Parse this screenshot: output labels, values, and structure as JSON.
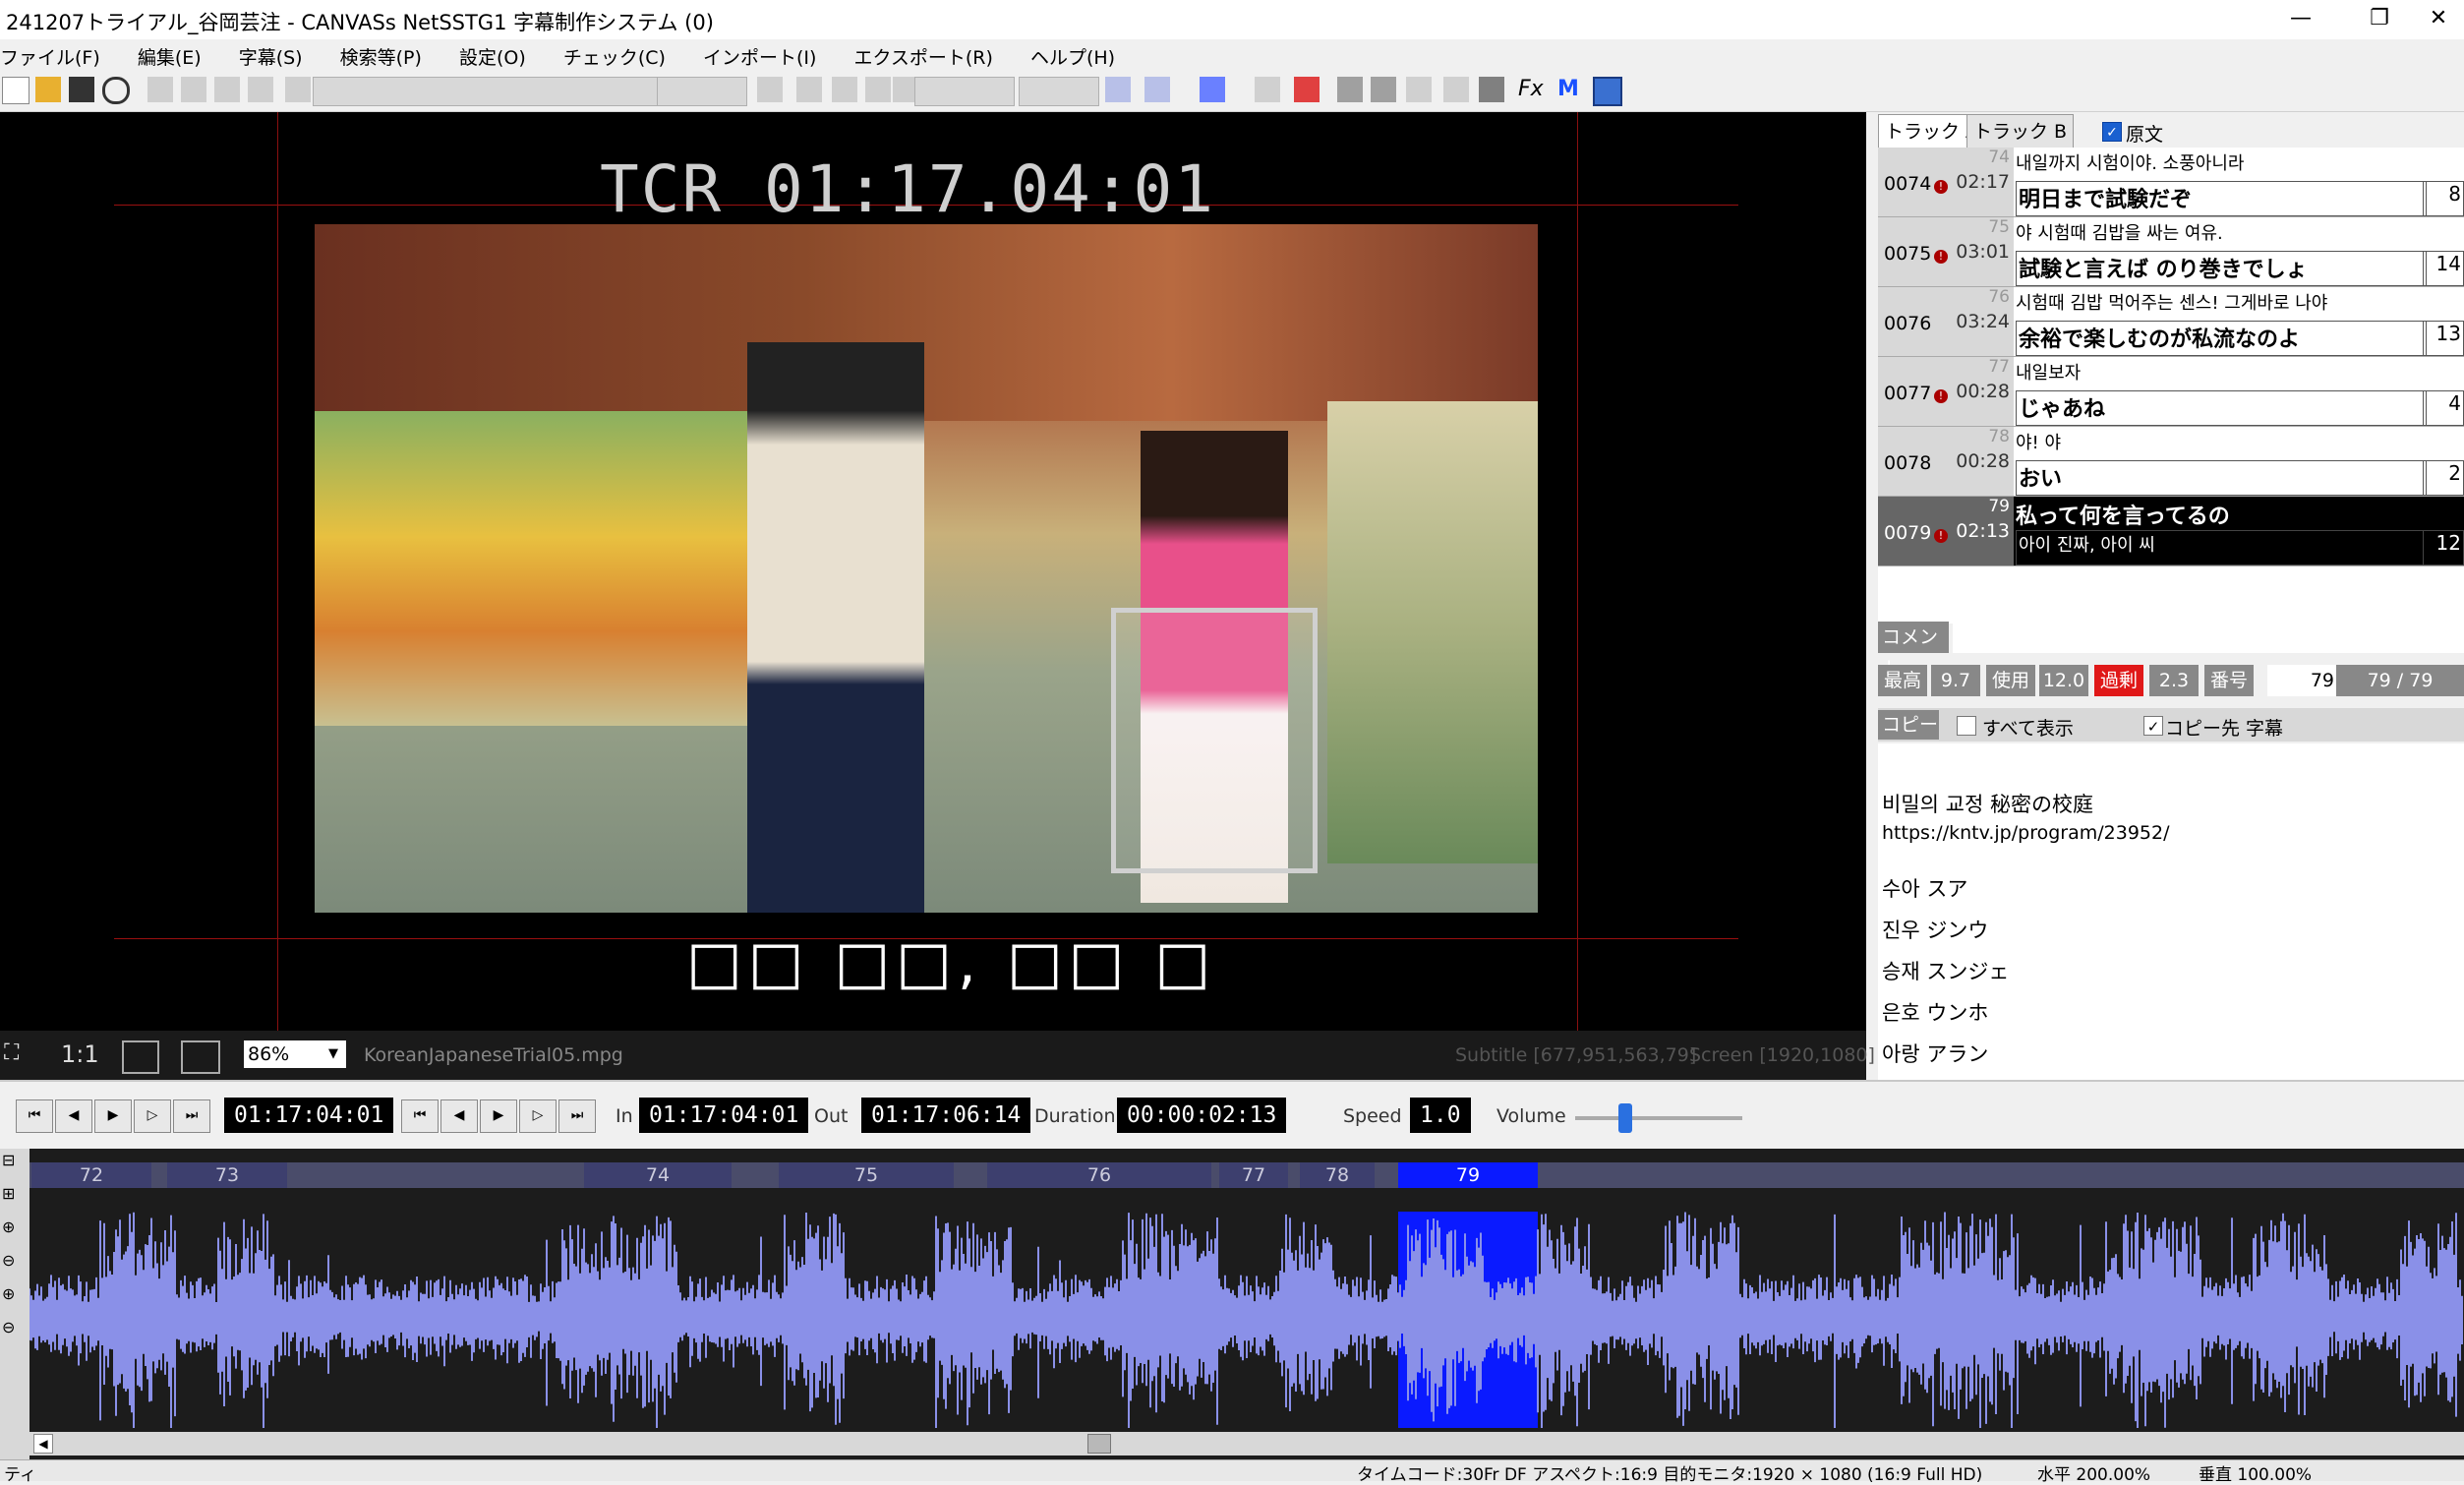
{
  "window": {
    "title": "241207トライアル_谷岡芸注 - CANVASs NetSSTG1 字幕制作システム (0)",
    "minimize": "—",
    "maximize": "❐",
    "close": "✕"
  },
  "menu": [
    "ファイル(F)",
    "編集(E)",
    "字幕(S)",
    "検索等(P)",
    "設定(O)",
    "チェック(C)",
    "インポート(I)",
    "エクスポート(R)",
    "ヘルプ(H)"
  ],
  "video": {
    "tcr": "TCR 01:17.04:01",
    "subtitle_render": "□□ □□, □□ □",
    "zoom": "86%",
    "one_to_one": "1:1",
    "filename": "KoreanJapaneseTrial05.mpg",
    "subtitle_info": "Subtitle [677,951,563,79]",
    "screen_info": "Screen [1920,1080]"
  },
  "transport": {
    "current": "01:17:04:01",
    "in_label": "In",
    "in": "01:17:04:01",
    "out_label": "Out",
    "out": "01:17:06:14",
    "duration_label": "Duration",
    "duration": "00:00:02:13",
    "speed_label": "Speed",
    "speed": "1.0",
    "volume_label": "Volume",
    "volume_level": 0.3
  },
  "panel": {
    "tabs": [
      "トラック A",
      "トラック B"
    ],
    "original_check": "原文",
    "rows": [
      {
        "num": "0074",
        "idx": "74",
        "dur": "02:17",
        "src": "내일까지 시험이야. 소풍아니라",
        "tgt": "明日まで試験だぞ",
        "cnt": "8",
        "mark": true
      },
      {
        "num": "0075",
        "idx": "75",
        "dur": "03:01",
        "src": "야 시험때 김밥을 싸는 여유.",
        "tgt": "試験と言えば のり巻きでしょ",
        "cnt": "14",
        "mark": true
      },
      {
        "num": "0076",
        "idx": "76",
        "dur": "03:24",
        "src": "시험때 김밥 먹어주는 센스! 그게바로 나야",
        "tgt": "余裕で楽しむのが私流なのよ",
        "cnt": "13",
        "mark": false
      },
      {
        "num": "0077",
        "idx": "77",
        "dur": "00:28",
        "src": "내일보자",
        "tgt": "じゃあね",
        "cnt": "4",
        "mark": true
      },
      {
        "num": "0078",
        "idx": "78",
        "dur": "00:28",
        "src": "야! 야",
        "tgt": "おい",
        "cnt": "2",
        "mark": false
      },
      {
        "num": "0079",
        "idx": "79",
        "dur": "02:13",
        "src": "私って何を言ってるの",
        "tgt": "아이 진짜, 아이 씨",
        "cnt": "12",
        "mark": true
      }
    ],
    "comment_label": "コメント",
    "stats": {
      "max_label": "最高",
      "max": "9.7",
      "use_label": "使用",
      "use": "12.0",
      "over_label": "過剰",
      "over": "2.3",
      "no_label": "番号",
      "no": "79",
      "pos": "79 / 79"
    },
    "copy_label": "コピー",
    "show_all": "すべて表示",
    "copy_dest": "コピー先 字幕",
    "memo": [
      "비밀의 교정 秘密の校庭",
      "https://kntv.jp/program/23952/",
      "수아 スア",
      "진우 ジンウ",
      "승재 スンジェ",
      "은호 ウンホ",
      "아랑 アラン"
    ]
  },
  "timeline": {
    "segments": [
      "72",
      "73",
      "74",
      "75",
      "76",
      "77",
      "78",
      "79"
    ],
    "selected": "79",
    "accent": "#0a1aff",
    "wave_color": "#8a90e8"
  },
  "statusbar": {
    "left": "ティ",
    "tc": "タイムコード:30Fr DF  アスペクト:16:9 目的モニタ:1920 × 1080 (16:9 Full HD)",
    "h": "水平 200.00%",
    "v": "垂直 100.00%"
  }
}
